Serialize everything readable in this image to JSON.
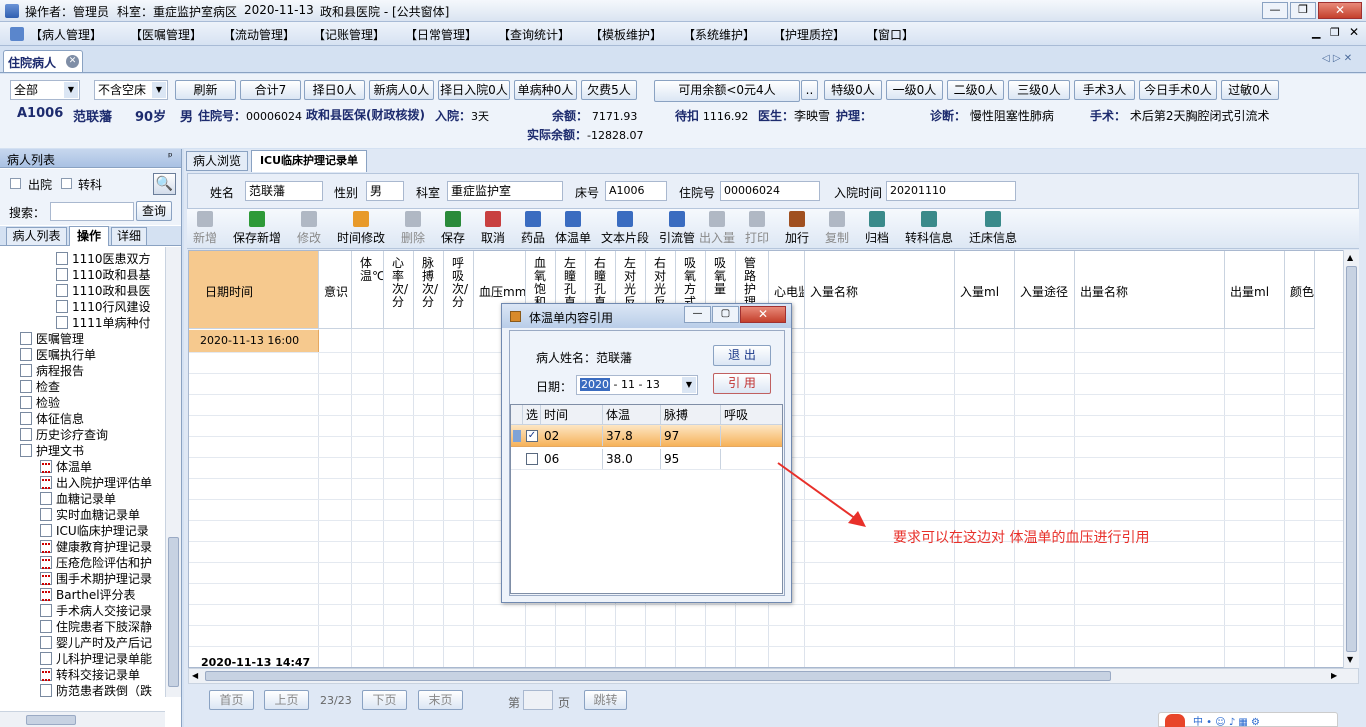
{
  "titlebar": {
    "operator": "操作者：管理员",
    "dept": "科室：重症监护室病区",
    "date": "2020-11-13",
    "hospital": "政和县医院 - [公共窗体]"
  },
  "menu": [
    "【病人管理】",
    "【医嘱管理】",
    "【流动管理】",
    "【记账管理】",
    "【日常管理】",
    "【查询统计】",
    "【模板维护】",
    "【系统维护】",
    "【护理质控】",
    "【窗口】"
  ],
  "doctab": {
    "title": "住院病人"
  },
  "controls": {
    "filter1": "全部",
    "filter2": "不含空床",
    "buttons": [
      "刷新",
      "合计7",
      "择日0人",
      "新病人0人",
      "择日入院0人",
      "单病种0人",
      "欠费5人"
    ],
    "balance_button": "可用余额<0元4人",
    "more": "..",
    "level_buttons": [
      "特级0人",
      "一级0人",
      "二级0人",
      "三级0人",
      "手术3人",
      "今日手术0人",
      "过敏0人"
    ]
  },
  "patient": {
    "bed": "A1006",
    "name": "范联藩",
    "age": "90岁",
    "sex": "男",
    "inpatient_no_label": "住院号：",
    "inpatient_no": "00006024",
    "insurance": "政和县医保(财政核拨)",
    "admit_label": "入院：",
    "admit_days": "3天",
    "balance_label": "余额：",
    "balance": "7171.93",
    "pending_label": "待扣",
    "pending": "1116.92",
    "doctor_label": "医生：",
    "doctor": "李映雪",
    "nurse_label": "护理：",
    "diagnosis_label": "诊断：",
    "diagnosis": "慢性阻塞性肺病",
    "surgery_label": "手术：",
    "surgery": "术后第2天胸腔闭式引流术",
    "actual_balance_label": "实际余额：",
    "actual_balance": "-12828.07"
  },
  "left": {
    "header": "病人列表",
    "pin": "ᵖ",
    "discharged": "出院",
    "transferred": "转科",
    "search_label": "搜索：",
    "search_button": "查询",
    "tabs": [
      "病人列表",
      "操作",
      "详细"
    ],
    "tree": [
      {
        "label": "1110医患双方",
        "indent": 70,
        "red": false
      },
      {
        "label": "1110政和县基",
        "indent": 70,
        "red": false
      },
      {
        "label": "1110政和县医",
        "indent": 70,
        "red": false
      },
      {
        "label": "1110行风建设",
        "indent": 70,
        "red": false
      },
      {
        "label": "1111单病种付",
        "indent": 70,
        "red": false
      },
      {
        "label": "医嘱管理",
        "indent": 34,
        "red": false
      },
      {
        "label": "医嘱执行单",
        "indent": 34,
        "red": false
      },
      {
        "label": "病程报告",
        "indent": 34,
        "red": false
      },
      {
        "label": "检查",
        "indent": 34,
        "red": false
      },
      {
        "label": "检验",
        "indent": 34,
        "red": false
      },
      {
        "label": "体征信息",
        "indent": 34,
        "red": false
      },
      {
        "label": "历史诊疗查询",
        "indent": 34,
        "red": false
      },
      {
        "label": "护理文书",
        "indent": 34,
        "red": false
      },
      {
        "label": "体温单",
        "indent": 54,
        "red": true
      },
      {
        "label": "出入院护理评估单",
        "indent": 54,
        "red": true
      },
      {
        "label": "血糖记录单",
        "indent": 54,
        "red": false
      },
      {
        "label": "实时血糖记录单",
        "indent": 54,
        "red": false
      },
      {
        "label": "ICU临床护理记录",
        "indent": 54,
        "red": false
      },
      {
        "label": "健康教育护理记录",
        "indent": 54,
        "red": true
      },
      {
        "label": "压疮危险评估和护",
        "indent": 54,
        "red": true
      },
      {
        "label": "围手术期护理记录",
        "indent": 54,
        "red": true
      },
      {
        "label": "Barthel评分表",
        "indent": 54,
        "red": true
      },
      {
        "label": "手术病人交接记录",
        "indent": 54,
        "red": false
      },
      {
        "label": "住院患者下肢深静",
        "indent": 54,
        "red": false
      },
      {
        "label": "婴儿产时及产后记",
        "indent": 54,
        "red": false
      },
      {
        "label": "儿科护理记录单能",
        "indent": 54,
        "red": false
      },
      {
        "label": "转科交接记录单",
        "indent": 54,
        "red": true
      },
      {
        "label": "防范患者跌倒（跌",
        "indent": 54,
        "red": false
      }
    ]
  },
  "right": {
    "tabs": [
      "病人浏览",
      "ICU临床护理记录单"
    ],
    "form": {
      "name_label": "姓名",
      "name": "范联藩",
      "sex_label": "性别",
      "sex": "男",
      "dept_label": "科室",
      "dept": "重症监护室",
      "bed_label": "床号",
      "bed": "A1006",
      "inpatient_label": "住院号",
      "inpatient": "00006024",
      "admit_label": "入院时间",
      "admit": "20201110"
    },
    "toolbar": [
      {
        "label": "新增",
        "color": "#b0b8c4"
      },
      {
        "label": "保存新增",
        "color": "#2e9a38"
      },
      {
        "label": "修改",
        "color": "#b0b8c4"
      },
      {
        "label": "时间修改",
        "color": "#e89a2a"
      },
      {
        "label": "删除",
        "color": "#b0b8c4"
      },
      {
        "label": "保存",
        "color": "#2a8a3a"
      },
      {
        "label": "取消",
        "color": "#c84040"
      },
      {
        "label": "药品",
        "color": "#3a6cc0"
      },
      {
        "label": "体温单",
        "color": "#3a6cc0"
      },
      {
        "label": "文本片段",
        "color": "#3a6cc0"
      },
      {
        "label": "引流管",
        "color": "#3a6cc0"
      },
      {
        "label": "出入量",
        "color": "#b0b8c4"
      },
      {
        "label": "打印",
        "color": "#b0b8c4"
      },
      {
        "label": "加行",
        "color": "#a05020"
      },
      {
        "label": "复制",
        "color": "#b0b8c4"
      },
      {
        "label": "归档",
        "color": "#3a8a8a"
      },
      {
        "label": "转科信息",
        "color": "#3a8a8a"
      },
      {
        "label": "迁床信息",
        "color": "#3a8a8a"
      }
    ],
    "grid_headers": [
      {
        "text": "日期时间",
        "w": 130,
        "v": false
      },
      {
        "text": "意识",
        "w": 33,
        "v": false
      },
      {
        "text": "体温℃",
        "w": 32,
        "v": true
      },
      {
        "text": "心率次/分",
        "w": 30,
        "v": true
      },
      {
        "text": "脉搏次/分",
        "w": 30,
        "v": true
      },
      {
        "text": "呼吸次/分",
        "w": 30,
        "v": true
      },
      {
        "text": "血压mmHg",
        "w": 52,
        "v": false
      },
      {
        "text": "血氧饱和度%",
        "w": 30,
        "v": true
      },
      {
        "text": "左瞳孔直径",
        "w": 30,
        "v": true
      },
      {
        "text": "右瞳孔直径",
        "w": 30,
        "v": true
      },
      {
        "text": "左对光反射",
        "w": 30,
        "v": true
      },
      {
        "text": "右对光反射",
        "w": 30,
        "v": true
      },
      {
        "text": "吸氧方式",
        "w": 30,
        "v": true
      },
      {
        "text": "吸氧量",
        "w": 30,
        "v": true
      },
      {
        "text": "管路护理",
        "w": 33,
        "v": true
      },
      {
        "text": "心电监护",
        "w": 36,
        "v": false
      },
      {
        "text": "入量名称",
        "w": 150,
        "v": false
      },
      {
        "text": "入量ml",
        "w": 60,
        "v": false
      },
      {
        "text": "入量途径",
        "w": 60,
        "v": false
      },
      {
        "text": "出量名称",
        "w": 150,
        "v": false
      },
      {
        "text": "出量ml",
        "w": 60,
        "v": false
      },
      {
        "text": "颜色",
        "w": 30,
        "v": false
      }
    ],
    "first_row_time": "2020-11-13 16:00",
    "last_row_time": "2020-11-13 14:47",
    "pager": {
      "first": "首页",
      "prev": "上页",
      "count": "23/23",
      "next": "下页",
      "last": "末页",
      "page_label": "第",
      "page_unit": "页",
      "go": "跳转"
    }
  },
  "dialog": {
    "title": "体温单内容引用",
    "patient_label": "病人姓名：范联藩",
    "date_label": "日期：",
    "date_year": "2020",
    "date_rest": "- 11 - 13",
    "exit_button": "退 出",
    "quote_button": "引 用",
    "columns": [
      "选",
      "时间",
      "体温",
      "脉搏",
      "呼吸"
    ],
    "rows": [
      {
        "checked": true,
        "time": "02",
        "temp": "37.8",
        "pulse": "97",
        "resp": ""
      },
      {
        "checked": false,
        "time": "06",
        "temp": "38.0",
        "pulse": "95",
        "resp": ""
      }
    ]
  },
  "annotation": "要求可以在这边对 体温单的血压进行引用"
}
